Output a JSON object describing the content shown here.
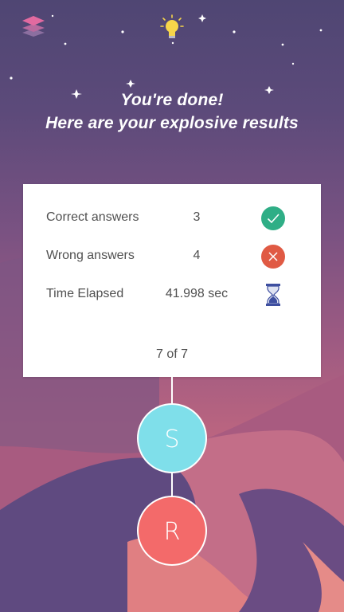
{
  "header": {
    "line1": "You're done!",
    "line2": "Here are your explosive results"
  },
  "results": {
    "rows": [
      {
        "label": "Correct answers",
        "value": "3",
        "icon": "check-icon",
        "color": "#2fae86"
      },
      {
        "label": "Wrong answers",
        "value": "4",
        "icon": "close-icon",
        "color": "#e05a44"
      },
      {
        "label": "Time Elapsed",
        "value": "41.998 sec",
        "icon": "hourglass-icon",
        "color": "#3e4fa0"
      }
    ],
    "progress": "7 of 7"
  },
  "buttons": {
    "share_label": "S",
    "restart_label": "R"
  },
  "colors": {
    "share": "#7fdfea",
    "restart": "#f36a6a",
    "layers_icon": "#e26aa0",
    "bulb_icon": "#f7d54a"
  }
}
